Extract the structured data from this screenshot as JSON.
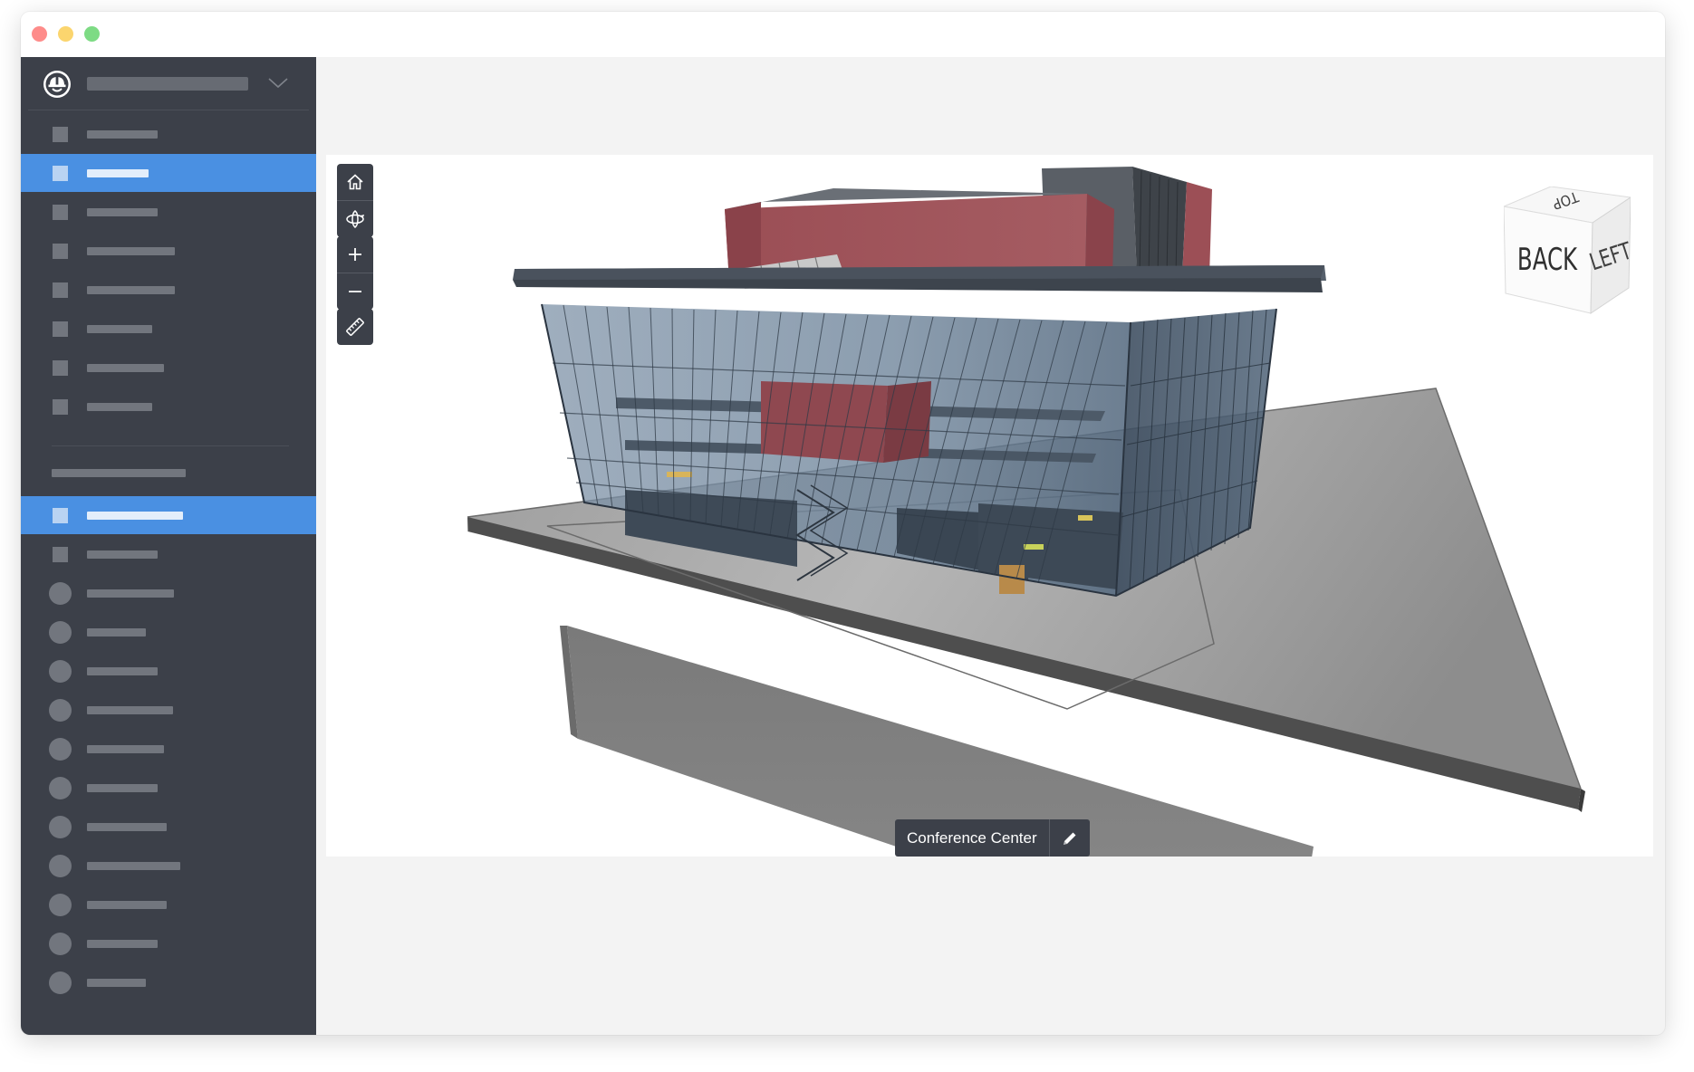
{
  "window": {
    "controls": [
      "close",
      "minimize",
      "maximize"
    ]
  },
  "sidebar": {
    "logo_icon": "hardhat-logo-icon",
    "dropdown_icon": "chevron-down-icon",
    "top_items": [
      {
        "icon": "square",
        "active": false
      },
      {
        "icon": "square",
        "active": true
      },
      {
        "icon": "square",
        "active": false
      },
      {
        "icon": "square",
        "active": false
      },
      {
        "icon": "square",
        "active": false
      },
      {
        "icon": "square",
        "active": false
      },
      {
        "icon": "square",
        "active": false
      },
      {
        "icon": "square",
        "active": false
      }
    ],
    "bottom_items": [
      {
        "icon": "square",
        "active": true
      },
      {
        "icon": "square",
        "active": false
      },
      {
        "icon": "circle",
        "active": false
      },
      {
        "icon": "circle",
        "active": false
      },
      {
        "icon": "circle",
        "active": false
      },
      {
        "icon": "circle",
        "active": false
      },
      {
        "icon": "circle",
        "active": false
      },
      {
        "icon": "circle",
        "active": false
      },
      {
        "icon": "circle",
        "active": false
      },
      {
        "icon": "circle",
        "active": false
      },
      {
        "icon": "circle",
        "active": false
      },
      {
        "icon": "circle",
        "active": false
      },
      {
        "icon": "circle",
        "active": false
      }
    ]
  },
  "viewer": {
    "toolbar": [
      {
        "name": "home-icon"
      },
      {
        "name": "orbit-icon"
      },
      {
        "name": "zoom-in-icon"
      },
      {
        "name": "zoom-out-icon"
      },
      {
        "name": "measure-ruler-icon"
      }
    ],
    "nav_cube": {
      "top": "TOP",
      "front": "BACK",
      "side": "LEFT"
    },
    "model": {
      "name": "Conference Center",
      "edit_icon": "pencil-icon"
    }
  },
  "colors": {
    "sidebar_bg": "#3c4049",
    "accent": "#4a90e2",
    "facade": "#a2585d",
    "glass": "#7a90a6"
  }
}
